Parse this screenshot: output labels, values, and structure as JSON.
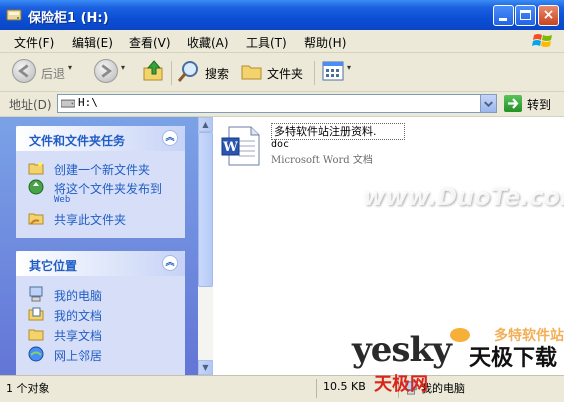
{
  "window": {
    "title": "保险柜1 (H:)",
    "controls": {
      "close_glyph": "×"
    }
  },
  "menu": [
    "文件(F)",
    "编辑(E)",
    "查看(V)",
    "收藏(A)",
    "工具(T)",
    "帮助(H)"
  ],
  "toolbar": {
    "back_label": "后退",
    "search_label": "搜索",
    "folders_label": "文件夹"
  },
  "address": {
    "label": "地址(D)",
    "value": "H:\\",
    "go_label": "转到"
  },
  "tasks": {
    "file_folder": {
      "title": "文件和文件夹任务",
      "items": [
        {
          "label": "创建一个新文件夹",
          "icon": "new-folder-icon"
        },
        {
          "label": "将这个文件夹发布到",
          "label2": "Web",
          "icon": "publish-web-icon"
        },
        {
          "label": "共享此文件夹",
          "icon": "share-folder-icon"
        }
      ]
    },
    "other_places": {
      "title": "其它位置",
      "items": [
        {
          "label": "我的电脑",
          "icon": "my-computer-icon"
        },
        {
          "label": "我的文档",
          "icon": "my-documents-icon"
        },
        {
          "label": "共享文档",
          "icon": "shared-documents-icon"
        },
        {
          "label": "网上邻居",
          "icon": "network-places-icon"
        }
      ]
    }
  },
  "files": [
    {
      "name": "多特软件站注册资料.",
      "ext": "doc",
      "type": "Microsoft Word 文档",
      "icon": "word-document-icon"
    }
  ],
  "status": {
    "objects": "1 个对象",
    "size": "10.5 KB",
    "location": "我的电脑"
  },
  "watermarks": {
    "duote": "www.DuoTe.com",
    "duote_sub": "多特软件站",
    "yesky_latin": "yesky",
    "yesky_cn": "天极下载",
    "yesky_red": "天极网"
  },
  "colors": {
    "title_bar": "#0b4fd6",
    "task_link": "#215dc6",
    "task_pane": "#6375d6",
    "group_body": "#d6dff7"
  }
}
